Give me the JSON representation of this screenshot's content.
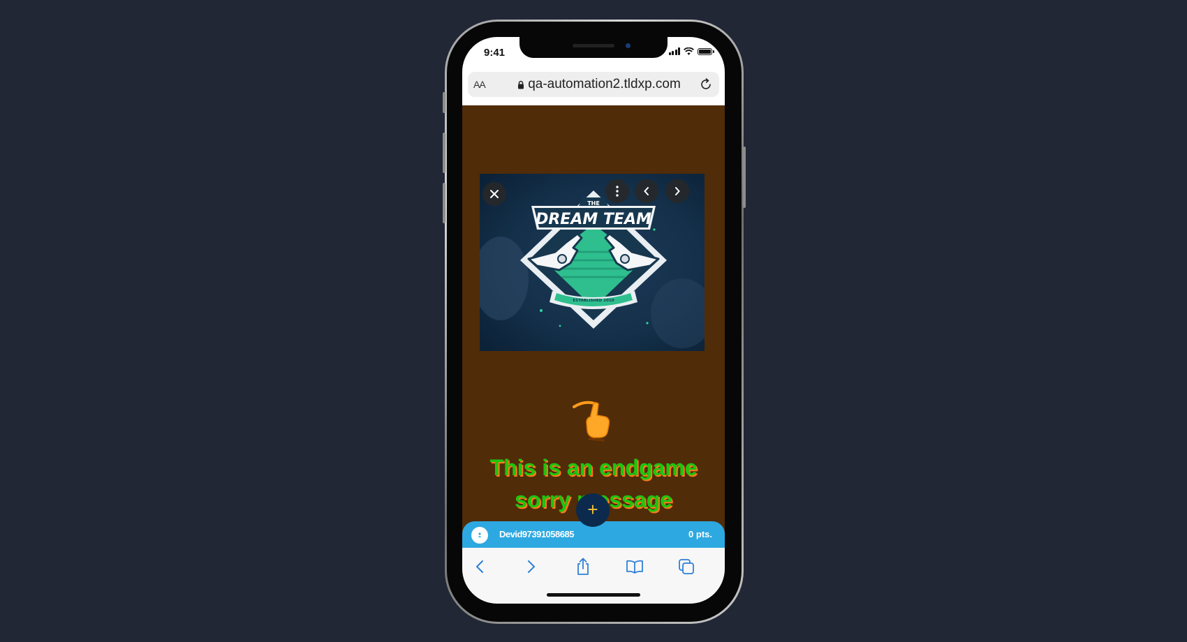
{
  "status_bar": {
    "time": "9:41"
  },
  "address_bar": {
    "text_size_label": "AA",
    "url": "qa-automation2.tldxp.com"
  },
  "banner": {
    "logo_small_text": "THE",
    "logo_title": "DREAM TEAM",
    "logo_ribbon": "ESTABLISHED 2010"
  },
  "message": {
    "line1": "This is an endgame",
    "line2": "sorry message"
  },
  "fab": {
    "label": "+"
  },
  "user_bar": {
    "username": "Devid97391058685",
    "points": "0 pts."
  },
  "colors": {
    "page_background": "#212735",
    "content_background": "#512c09",
    "user_bar": "#2ea8e0",
    "message_text": "#1fc40f",
    "message_shadow": "#ff7a1a",
    "fab": "#0c2a4d",
    "safari_icons": "#2f7fd6"
  }
}
